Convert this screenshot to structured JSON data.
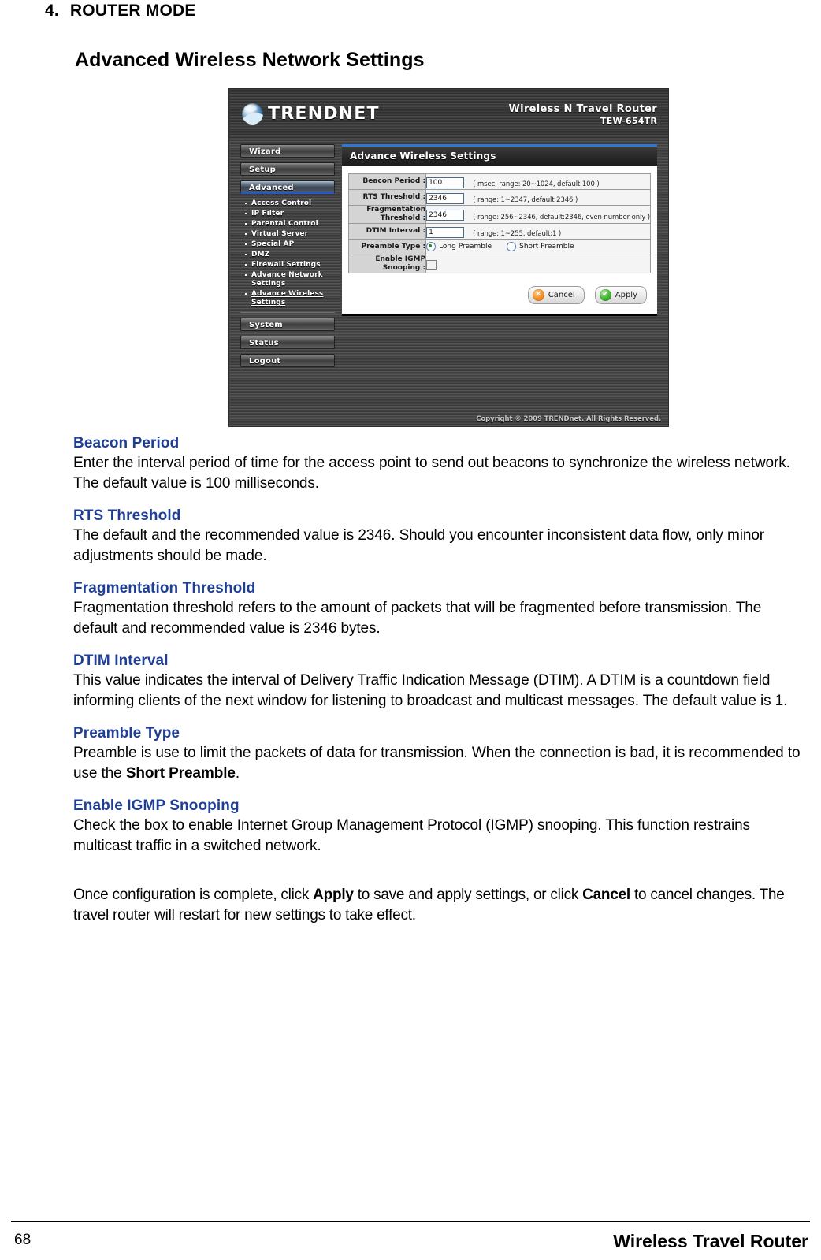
{
  "document": {
    "section_number": "4.",
    "section_title": "ROUTER MODE",
    "page_heading": "Advanced Wireless Network Settings",
    "footer": {
      "page_number": "68",
      "running_title": "Wireless Travel Router"
    }
  },
  "router_ui": {
    "brand_name": "TRENDNET",
    "product_name": "Wireless N Travel Router",
    "model": "TEW-654TR",
    "panel_title": "Advance Wireless Settings",
    "copyright": "Copyright © 2009 TRENDnet. All Rights Reserved.",
    "nav": {
      "wizard": "Wizard",
      "setup": "Setup",
      "advanced": "Advanced",
      "system": "System",
      "status": "Status",
      "logout": "Logout"
    },
    "submenu": [
      {
        "label": "Access Control",
        "current": false
      },
      {
        "label": "IP Filter",
        "current": false
      },
      {
        "label": "Parental Control",
        "current": false
      },
      {
        "label": "Virtual Server",
        "current": false
      },
      {
        "label": "Special AP",
        "current": false
      },
      {
        "label": "DMZ",
        "current": false
      },
      {
        "label": "Firewall Settings",
        "current": false
      },
      {
        "label": "Advance Network Settings",
        "current": false
      },
      {
        "label": "Advance Wireless Settings",
        "current": true
      }
    ],
    "fields": {
      "beacon_period": {
        "label": "Beacon Period :",
        "value": "100",
        "hint": "( msec, range: 20~1024, default 100 )"
      },
      "rts_threshold": {
        "label": "RTS Threshold :",
        "value": "2346",
        "hint": "( range: 1~2347, default 2346 )"
      },
      "fragmentation_threshold": {
        "label": "Fragmentation Threshold :",
        "value": "2346",
        "hint": "( range: 256~2346, default:2346, even number only )"
      },
      "dtim_interval": {
        "label": "DTIM Interval :",
        "value": "1",
        "hint": "( range: 1~255, default:1 )"
      },
      "preamble_type": {
        "label": "Preamble Type :",
        "options": [
          {
            "label": "Long Preamble",
            "selected": true
          },
          {
            "label": "Short Preamble",
            "selected": false
          }
        ]
      },
      "igmp_snooping": {
        "label": "Enable IGMP Snooping :",
        "checked": false
      }
    },
    "buttons": {
      "cancel": "Cancel",
      "cancel_icon": "cross-icon",
      "apply": "Apply",
      "apply_icon": "check-icon"
    },
    "accent_color": "#2f78d0"
  },
  "sections": [
    {
      "heading": "Beacon Period",
      "body": "Enter the interval period of time for the access point to send out beacons to synchronize the wireless network. The default value is 100 milliseconds."
    },
    {
      "heading": "RTS Threshold",
      "body": "The default and the recommended value is 2346. Should you encounter inconsistent data flow, only minor adjustments should be made."
    },
    {
      "heading": "Fragmentation Threshold",
      "body": "Fragmentation threshold refers to the amount of packets that will be fragmented before transmission. The default and recommended value is 2346 bytes."
    },
    {
      "heading": "DTIM Interval",
      "body": "This value indicates the interval of Delivery Traffic Indication Message (DTIM). A DTIM is a countdown field informing clients of the next window for listening to broadcast and multicast messages. The default value is 1."
    },
    {
      "heading": "Preamble Type",
      "body_pre": "Preamble is use to limit the packets of data for transmission. When the connection is bad, it is recommended to use the ",
      "body_bold": "Short Preamble",
      "body_post": "."
    },
    {
      "heading": "Enable IGMP Snooping",
      "body": "Check the box to enable Internet Group Management Protocol (IGMP) snooping. This function restrains multicast traffic in a switched network."
    }
  ],
  "closing": {
    "pre": "Once configuration is complete, click ",
    "bold1": "Apply",
    "mid": " to save and apply settings, or click ",
    "bold2": "Cancel",
    "post": " to cancel changes. The travel router will restart for new settings to take effect."
  },
  "heading_color": "#1f3f96"
}
